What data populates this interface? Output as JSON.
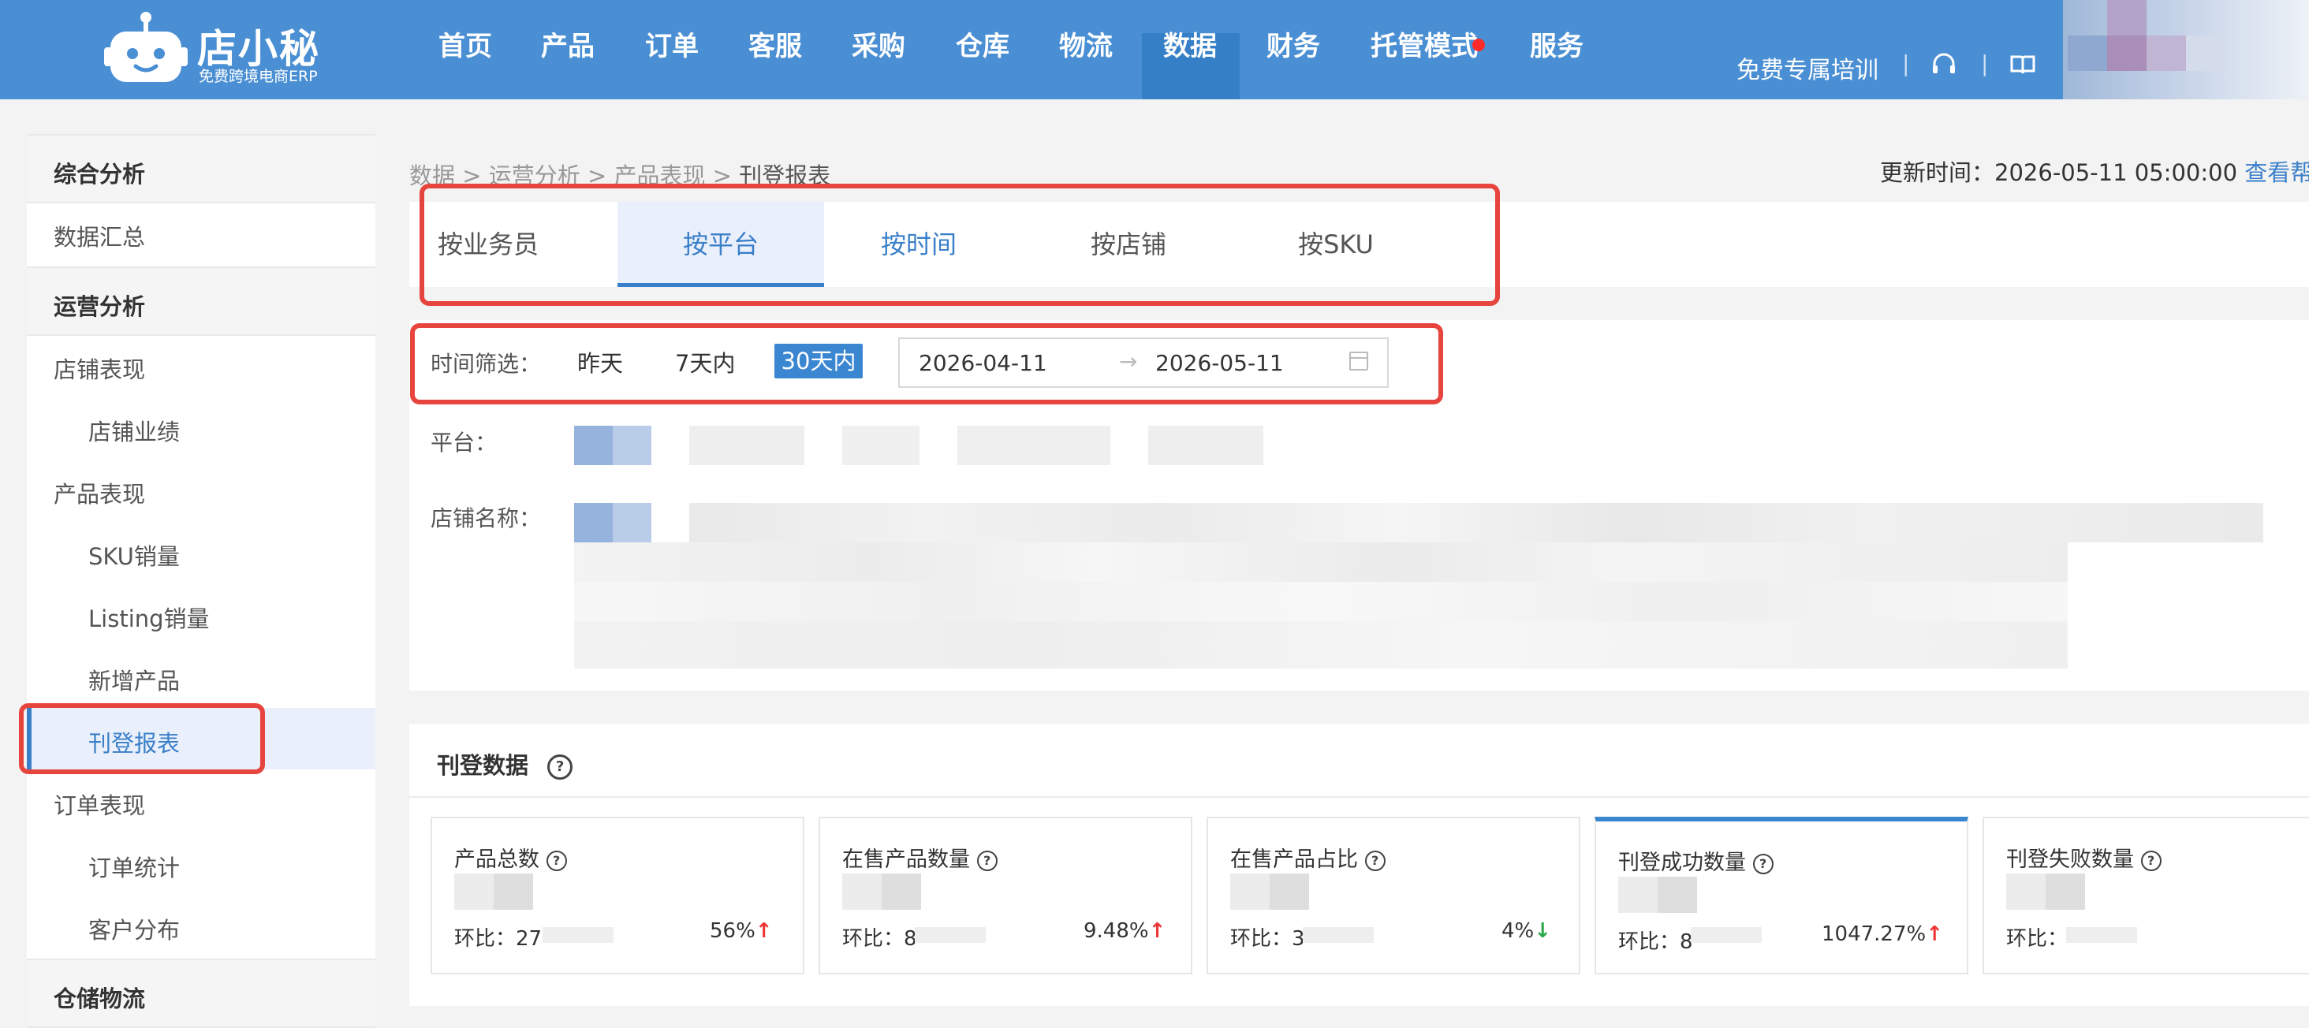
{
  "header": {
    "logo_name": "店小秘",
    "logo_sub": "免费跨境电商ERP",
    "nav": [
      "首页",
      "产品",
      "订单",
      "客服",
      "采购",
      "仓库",
      "物流",
      "数据",
      "财务",
      "托管模式",
      "服务"
    ],
    "active_nav": "数据",
    "training_link": "免费专属培训",
    "separator": "|"
  },
  "sidebar": {
    "group_overall": "综合分析",
    "item_summary": "数据汇总",
    "group_ops": "运营分析",
    "store_perf": "店铺表现",
    "store_results": "店铺业绩",
    "product_perf": "产品表现",
    "sku_sales": "SKU销量",
    "listing_sales": "Listing销量",
    "new_products": "新增产品",
    "listing_report": "刊登报表",
    "order_perf": "订单表现",
    "order_stats": "订单统计",
    "customer_dist": "客户分布",
    "group_warehouse": "仓储物流"
  },
  "breadcrumb": {
    "c1": "数据",
    "c2": "运营分析",
    "c3": "产品表现",
    "current": "刊登报表",
    "sep": ">"
  },
  "update": {
    "label": "更新时间：",
    "time": "2026-05-11 05:00:00",
    "help": "查看帮助"
  },
  "tabs": [
    "按业务员",
    "按平台",
    "按时间",
    "按店铺",
    "按SKU"
  ],
  "active_tab": "按平台",
  "filter": {
    "time_label": "时间筛选：",
    "opt_yesterday": "昨天",
    "opt_7days": "7天内",
    "opt_30days": "30天内",
    "start_date": "2026-04-11",
    "end_date": "2026-05-11",
    "arrow": "→",
    "platform_label": "平台：",
    "store_label": "店铺名称："
  },
  "stats": {
    "title": "刊登数据",
    "help": "?",
    "compare_label": "环比：",
    "cards": [
      {
        "label": "产品总数",
        "cmp_prefix": "27",
        "pct_suffix": "56%",
        "trend": "up"
      },
      {
        "label": "在售产品数量",
        "cmp_prefix": "8",
        "pct_suffix": "9.48%",
        "trend": "up"
      },
      {
        "label": "在售产品占比",
        "cmp_prefix": "3",
        "pct_suffix": "4%",
        "trend": "down"
      },
      {
        "label": "刊登成功数量",
        "cmp_prefix": "8",
        "pct_suffix": "1047.27%",
        "trend": "up"
      },
      {
        "label": "刊登失败数量",
        "cmp_prefix": "",
        "pct_suffix": "",
        "trend": ""
      }
    ],
    "up_arrow": "↑",
    "down_arrow": "↓"
  },
  "colors": {
    "header_bg": "#4a8fd3",
    "accent": "#3a7fc9",
    "annotation_red": "#e6443d",
    "up": "#e33333",
    "down": "#2aa84a"
  }
}
